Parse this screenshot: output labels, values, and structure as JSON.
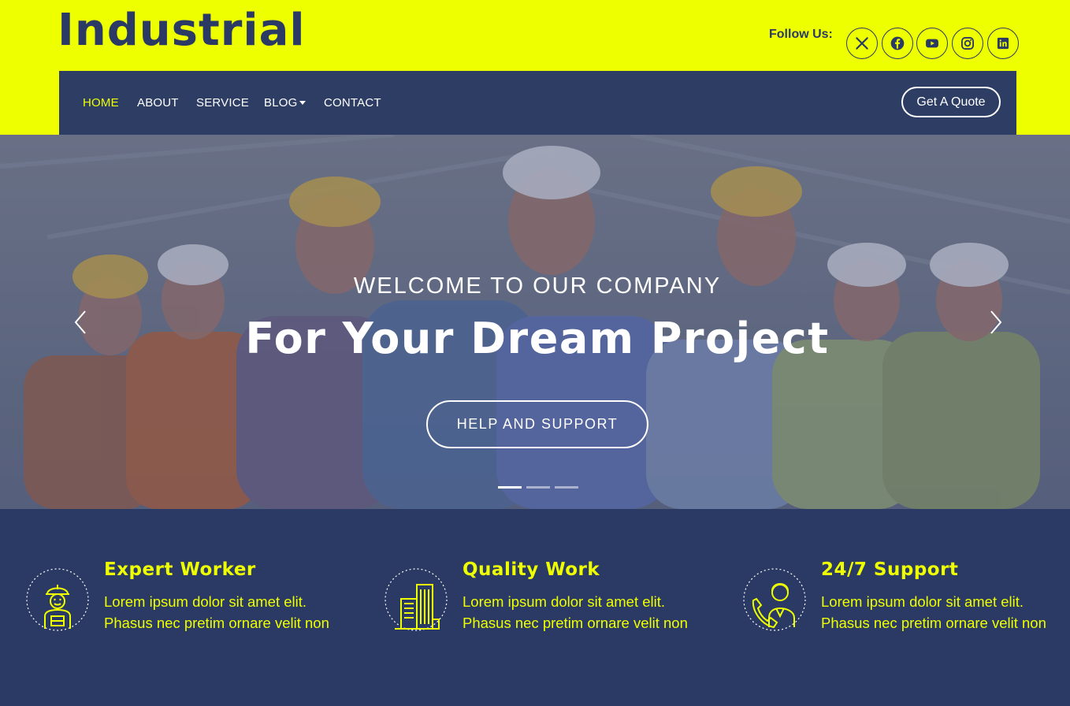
{
  "header": {
    "brand": "Industrial",
    "follow_label": "Follow Us:",
    "social": [
      {
        "icon": "x-twitter-icon"
      },
      {
        "icon": "facebook-icon"
      },
      {
        "icon": "youtube-icon"
      },
      {
        "icon": "instagram-icon"
      },
      {
        "icon": "linkedin-icon"
      }
    ]
  },
  "nav": {
    "items": [
      {
        "label": "HOME",
        "active": true
      },
      {
        "label": "ABOUT"
      },
      {
        "label": "SERVICE"
      },
      {
        "label": "BLOG",
        "dropdown": true
      },
      {
        "label": "CONTACT"
      }
    ],
    "quote_label": "Get A Quote"
  },
  "hero": {
    "subtitle": "WELCOME TO OUR COMPANY",
    "title": "For Your Dream Project",
    "button_label": "HELP AND SUPPORT",
    "slides": 3,
    "active_slide": 1
  },
  "features": [
    {
      "title": "Expert Worker",
      "text": "Lorem ipsum dolor sit amet elit. Phasus nec pretim ornare velit non",
      "icon": "worker-icon"
    },
    {
      "title": "Quality Work",
      "text": "Lorem ipsum dolor sit amet elit. Phasus nec pretim ornare velit non",
      "icon": "buildings-icon"
    },
    {
      "title": "24/7 Support",
      "text": "Lorem ipsum dolor sit amet elit. Phasus nec pretim ornare velit non",
      "icon": "support-agent-icon"
    }
  ],
  "colors": {
    "accent": "#eeff00",
    "navy": "#2b3a64",
    "white": "#ffffff"
  }
}
